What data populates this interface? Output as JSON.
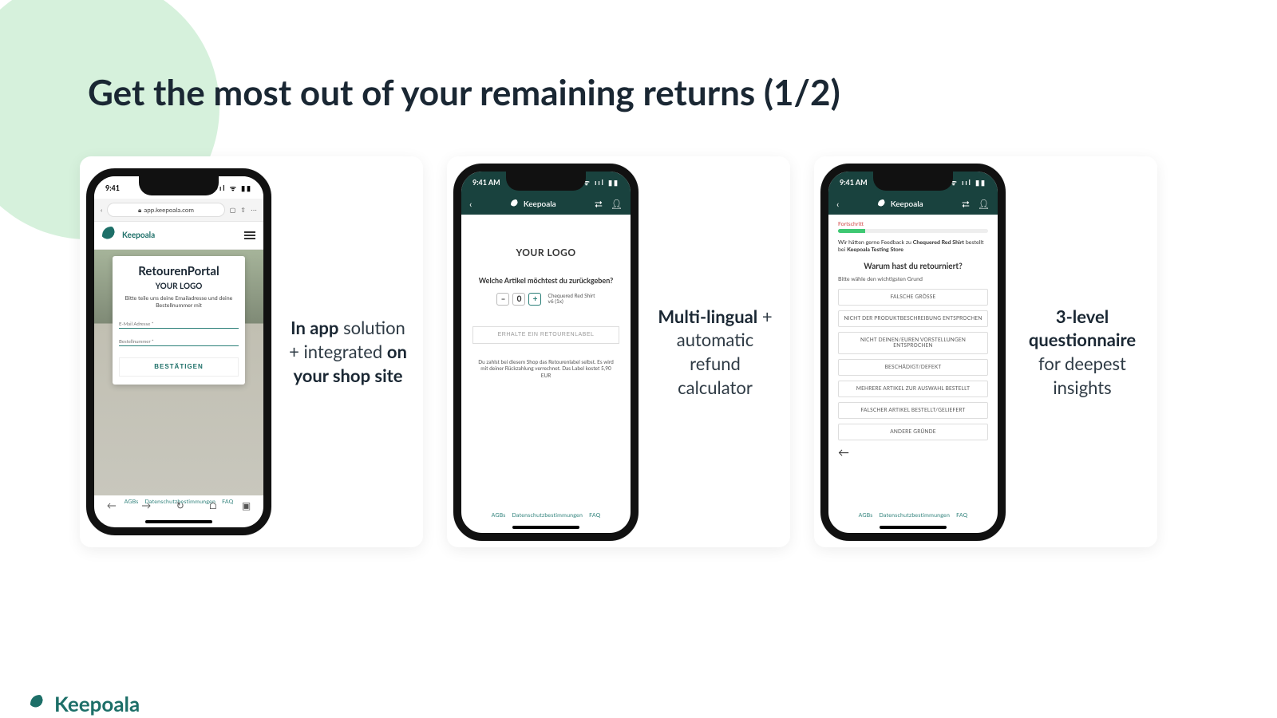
{
  "slide": {
    "title": "Get the most out of your remaining returns (1/2)"
  },
  "brand": {
    "name": "Keepoala"
  },
  "card1": {
    "desc_html": "<b>In app</b> solution + integrated <b>on your shop site</b>",
    "phone": {
      "time": "9:41",
      "signals": "📶 📡 🔋",
      "url": "app.keepoala.com",
      "app_name": "Keepoala",
      "portal_title": "RetourenPortal",
      "your_logo": "YOUR LOGO",
      "instruction": "Bitte teile uns deine Emailadresse und deine Bestellnummer mit",
      "field_email": "E-Mail Adresse *",
      "field_order": "Bestellnummer *",
      "confirm": "BESTÄTIGEN",
      "footer": {
        "agb": "AGBs",
        "ds": "Datenschutzbestimmungen",
        "faq": "FAQ"
      }
    }
  },
  "card2": {
    "desc_html": "<b>Multi-lingual</b> + automatic refund calculator",
    "phone": {
      "time": "9:41 AM",
      "your_logo": "YOUR LOGO",
      "question": "Welche Artikel möchtest du zurückgeben?",
      "qty_minus": "–",
      "qty_val": "0",
      "qty_plus": "+",
      "item_name": "Chequered Red Shirt",
      "item_size": "v6 (1x)",
      "label_btn": "ERHALTE EIN RETOURENLABEL",
      "note": "Du zahlst bei diesem Shop das Retourenlabel selbst. Es wird mit deiner Rückzahlung verrechnet. Das Label kostet 5,90 EUR",
      "footer": {
        "agb": "AGBs",
        "ds": "Datenschutzbestimmungen",
        "faq": "FAQ"
      }
    }
  },
  "card3": {
    "desc_html": "<b>3-level questionnaire</b> for deepest insights",
    "phone": {
      "time": "9:41 AM",
      "progress_label": "Fortschritt",
      "lead_pre": "Wir hätten gerne Feedback zu ",
      "lead_bold1": "Chequered Red Shirt",
      "lead_mid": " bestellt bei ",
      "lead_bold2": "Keepoala Testing Store",
      "question": "Warum hast du retourniert?",
      "sub": "Bitte wähle den wichtigsten Grund",
      "options": [
        "FALSCHE GRÖSSE",
        "NICHT DER PRODUKTBESCHREIBUNG ENTSPROCHEN",
        "NICHT DEINEN/EUREN VORSTELLUNGEN ENTSPROCHEN",
        "BESCHÄDIGT/DEFEKT",
        "MEHRERE ARTIKEL ZUR AUSWAHL BESTELLT",
        "FALSCHER ARTIKEL BESTELLT/GELIEFERT",
        "ANDERE GRÜNDE"
      ],
      "footer": {
        "agb": "AGBs",
        "ds": "Datenschutzbestimmungen",
        "faq": "FAQ"
      }
    }
  }
}
